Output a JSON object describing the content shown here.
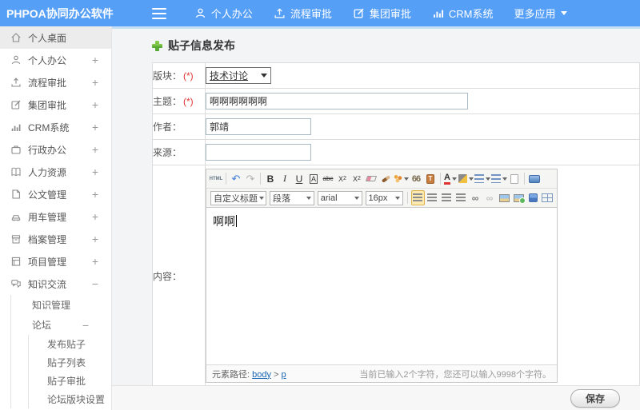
{
  "colors": {
    "topbar_blue": "#569ff7",
    "content_divider_blue": "#c3ddf5",
    "plus_green": "#4ea22e",
    "required_red": "#e53935",
    "link_blue": "#1a66b3"
  },
  "topbar": {
    "logo": "PHPOA协同办公软件",
    "nav": [
      {
        "label": "个人办公",
        "icon": "user-icon"
      },
      {
        "label": "流程审批",
        "icon": "upload-icon"
      },
      {
        "label": "集团审批",
        "icon": "edit-icon"
      },
      {
        "label": "CRM系统",
        "icon": "chart-icon"
      },
      {
        "label": "更多应用",
        "icon": "caret-down-icon"
      }
    ]
  },
  "sidebar": {
    "items": [
      {
        "label": "个人桌面",
        "expand": ""
      },
      {
        "label": "个人办公",
        "expand": "+"
      },
      {
        "label": "流程审批",
        "expand": "+"
      },
      {
        "label": "集团审批",
        "expand": "+"
      },
      {
        "label": "CRM系统",
        "expand": "+"
      },
      {
        "label": "行政办公",
        "expand": "+"
      },
      {
        "label": "人力资源",
        "expand": "+"
      },
      {
        "label": "公文管理",
        "expand": "+"
      },
      {
        "label": "用车管理",
        "expand": "+"
      },
      {
        "label": "档案管理",
        "expand": "+"
      },
      {
        "label": "项目管理",
        "expand": "+"
      },
      {
        "label": "知识交流",
        "expand": "−"
      }
    ],
    "sub1": [
      {
        "label": "知识管理",
        "expand": ""
      },
      {
        "label": "论坛",
        "expand": "−"
      }
    ],
    "sub2": [
      {
        "label": "发布贴子"
      },
      {
        "label": "贴子列表"
      },
      {
        "label": "贴子审批"
      },
      {
        "label": "论坛版块设置"
      }
    ]
  },
  "main": {
    "title": "贴子信息发布",
    "form": {
      "board_label": "版块：",
      "required": "(*)",
      "board_value": "技术讨论",
      "subject_label": "主题：",
      "subject_value": "啊啊啊啊啊啊",
      "author_label": "作者：",
      "author_value": "郭靖",
      "source_label": "来源：",
      "source_value": "",
      "content_label": "内容："
    },
    "editor": {
      "toolbar": {
        "html": "HTML",
        "undo": "↶",
        "redo": "↷",
        "bold": "B",
        "italic": "I",
        "underline": "U",
        "font_box": "A",
        "strike": "abc",
        "sup_base": "X",
        "sup": "2",
        "sub_base": "X",
        "sub": "2",
        "quote": "66",
        "clip": "T",
        "forecolor": "A",
        "link": "∞",
        "unlink": "∞",
        "heading": "自定义标题",
        "paragraph": "段落",
        "font": "arial",
        "size": "16px"
      },
      "content": "啊啊",
      "statusbar": {
        "path_label": "元素路径: ",
        "node_body": "body",
        "sep": " > ",
        "node_p": "p",
        "counter": "当前已输入2个字符，您还可以输入9998个字符。"
      }
    },
    "save_label": "保存"
  }
}
